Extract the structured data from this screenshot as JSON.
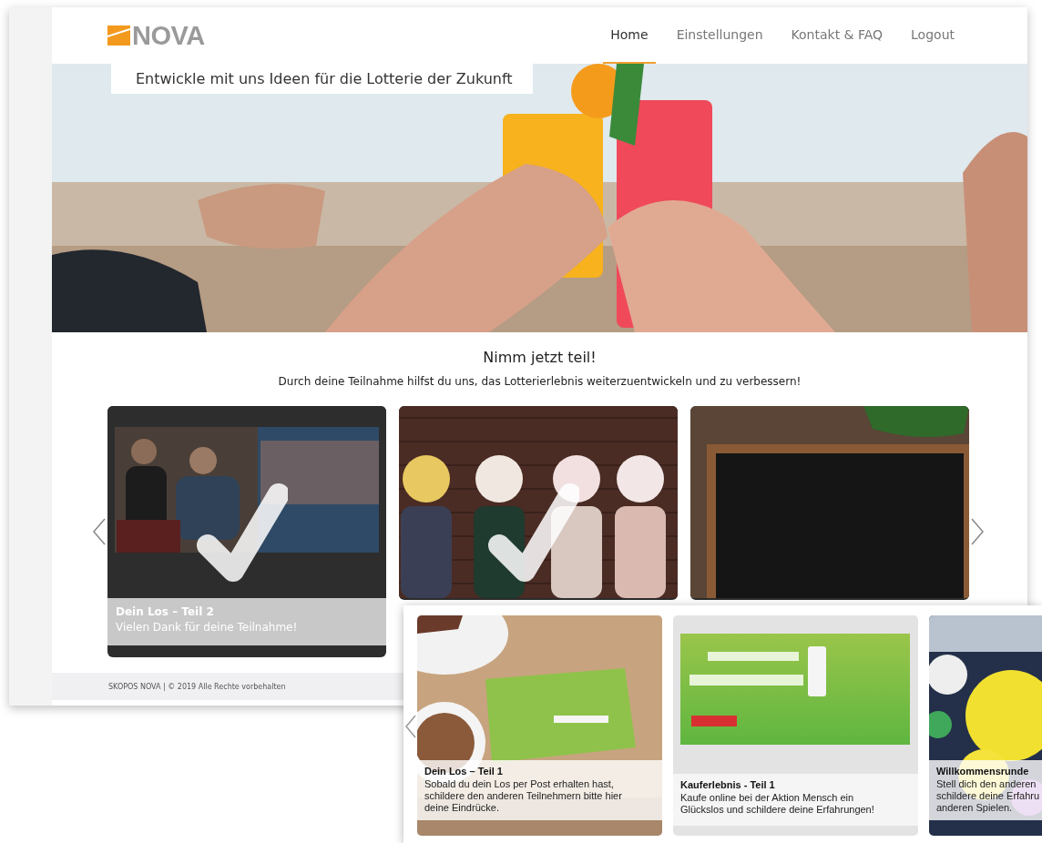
{
  "header": {
    "logo": "NOVA",
    "nav": [
      {
        "label": "Home",
        "selected": true
      },
      {
        "label": "Einstellungen",
        "selected": false
      },
      {
        "label": "Kontakt & FAQ",
        "selected": false
      },
      {
        "label": "Logout",
        "selected": false
      }
    ]
  },
  "hero": {
    "tagline": "Entwickle mit uns Ideen für die Lotterie der Zukunft"
  },
  "intro": {
    "title": "Nimm jetzt teil!",
    "text": "Durch deine Teilnahme hilfst du uns, das Lotterierlebnis weiterzuentwickeln und zu verbessern!"
  },
  "cards": [
    {
      "title": "Dein Los – Teil 2",
      "subtitle": "Vielen Dank für deine Teilnahme!",
      "completed": true
    },
    {
      "completed": true
    },
    {
      "completed": false
    }
  ],
  "footer": "SKOPOS NOVA | © 2019 Alle Rechte vorbehalten",
  "overlay_cards": [
    {
      "title": "Dein Los – Teil 1",
      "lines": [
        "Sobald du dein Los per Post erhalten hast,",
        "schildere den anderen Teilnehmern bitte hier",
        "deine Eindrücke."
      ]
    },
    {
      "kind": "banner",
      "title": "Kauferlebnis - Teil 1",
      "lines": [
        "Kaufe online bei der Aktion Mensch ein",
        "Glückslos und schildere deine Erfahrungen!"
      ]
    },
    {
      "title": "Willkommensrunde",
      "lines": [
        "Stell dich den anderen",
        "schildere deine Erfahru",
        "anderen Spielen."
      ]
    }
  ]
}
